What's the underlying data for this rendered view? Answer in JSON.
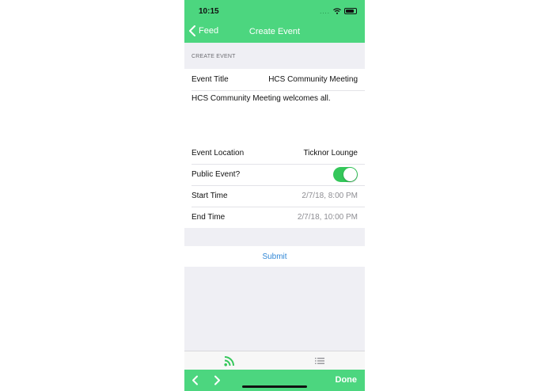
{
  "status": {
    "time": "10:15",
    "dots": "...."
  },
  "header": {
    "back_label": "Feed",
    "title": "Create Event"
  },
  "section": {
    "title": "CREATE EVENT"
  },
  "form": {
    "event_title_label": "Event Title",
    "event_title_value": "HCS Community Meeting",
    "description": "HCS Community Meeting welcomes all.",
    "location_label": "Event Location",
    "location_value": "Ticknor Lounge",
    "public_label": "Public Event?",
    "public_enabled": true,
    "start_label": "Start Time",
    "start_value": "2/7/18, 8:00 PM",
    "end_label": "End Time",
    "end_value": "2/7/18, 10:00 PM"
  },
  "submit_label": "Submit",
  "tabs": [
    {
      "icon": "rss-feed-icon",
      "active": true
    },
    {
      "icon": "list-icon",
      "active": false
    }
  ],
  "toolbar": {
    "done_label": "Done"
  },
  "colors": {
    "accent": "#4cd67f",
    "toggle": "#34c75a",
    "link": "#2f86d6"
  }
}
